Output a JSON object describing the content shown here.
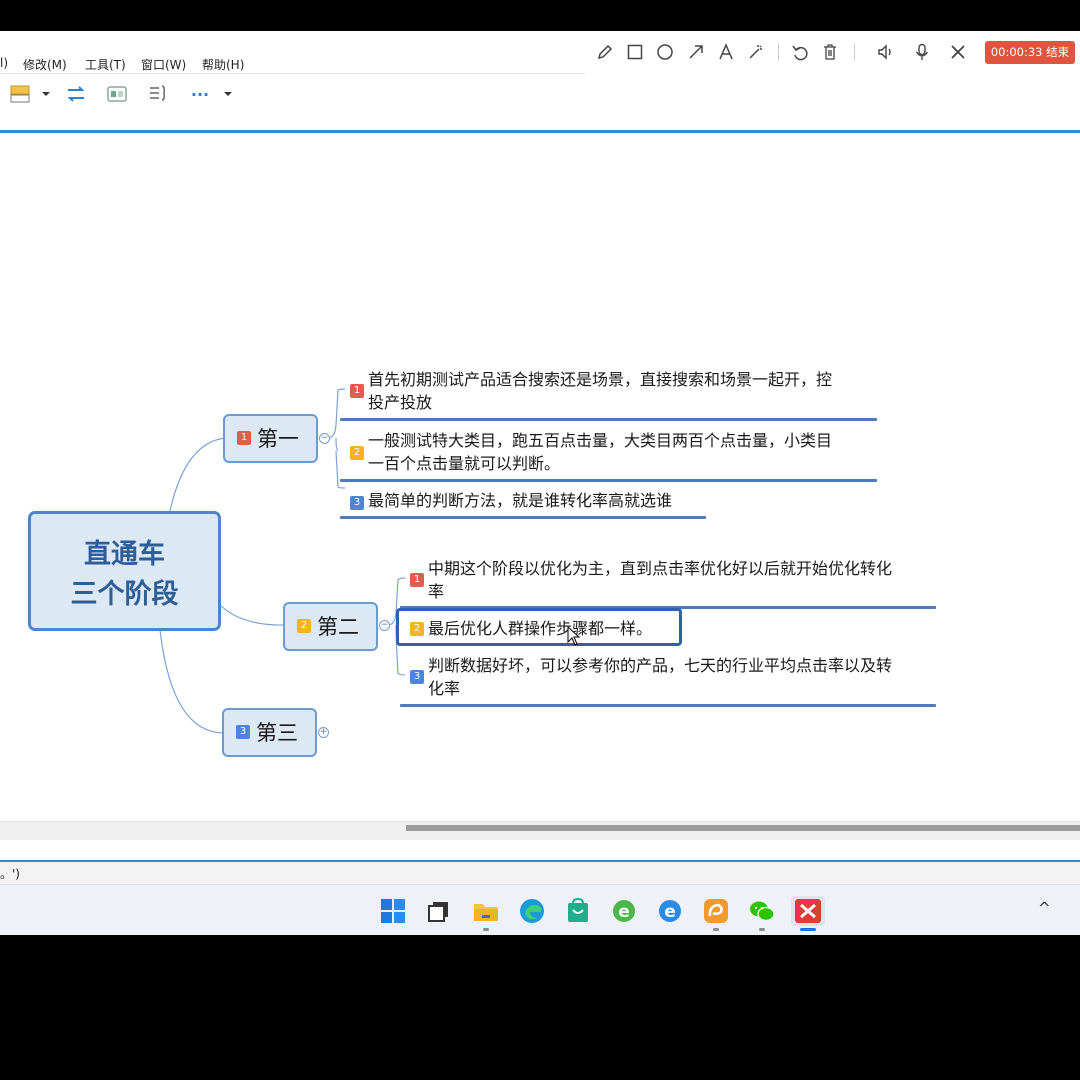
{
  "menu": [
    "l)",
    "修改(M)",
    "工具(T)",
    "窗口(W)",
    "帮助(H)"
  ],
  "recorder": {
    "tools": [
      "pencil-icon",
      "rectangle-icon",
      "circle-icon",
      "arrow-icon",
      "text-icon",
      "magic-wand-icon",
      "undo-icon",
      "delete-icon",
      "speaker-icon",
      "microphone-icon",
      "close-icon"
    ],
    "timer": "00:00:33 结束"
  },
  "toolbar": {
    "more_label": "···"
  },
  "mindmap": {
    "central": {
      "line1": "直通车",
      "line2": "三个阶段"
    },
    "branches": [
      {
        "num": "1",
        "label": "第一",
        "children": [
          {
            "num": "1",
            "line1": "首先初期测试产品适合搜索还是场景，直接搜索和场景一起开，控",
            "line2": "投产投放"
          },
          {
            "num": "2",
            "line1": "一般测试特大类目，跑五百点击量，大类目两百个点击量，小类目",
            "line2": "一百个点击量就可以判断。"
          },
          {
            "num": "3",
            "line1": "最简单的判断方法，就是谁转化率高就选谁",
            "line2": ""
          }
        ]
      },
      {
        "num": "2",
        "label": "第二",
        "children": [
          {
            "num": "1",
            "line1": "中期这个阶段以优化为主，直到点击率优化好以后就开始优化转化",
            "line2": "率"
          },
          {
            "num": "2",
            "line1": "最后优化人群操作步骤都一样。",
            "line2": ""
          },
          {
            "num": "3",
            "line1": "判断数据好坏，可以参考你的产品，七天的行业平均点击率以及转",
            "line2": "化率"
          }
        ]
      },
      {
        "num": "3",
        "label": "第三",
        "children": []
      }
    ]
  },
  "statusbar": {
    "text": "。')"
  },
  "taskbar": {
    "apps": [
      "windows-start-icon",
      "task-view-icon",
      "file-explorer-icon",
      "edge-icon",
      "store-icon",
      "ie-icon",
      "ie-blue-icon",
      "uc-browser-icon",
      "wechat-icon",
      "xmind-icon"
    ],
    "tray": "^"
  },
  "colors": {
    "accent": "#2d8ed6",
    "branch": "#4f7bbd",
    "timer": "#e0533f"
  }
}
